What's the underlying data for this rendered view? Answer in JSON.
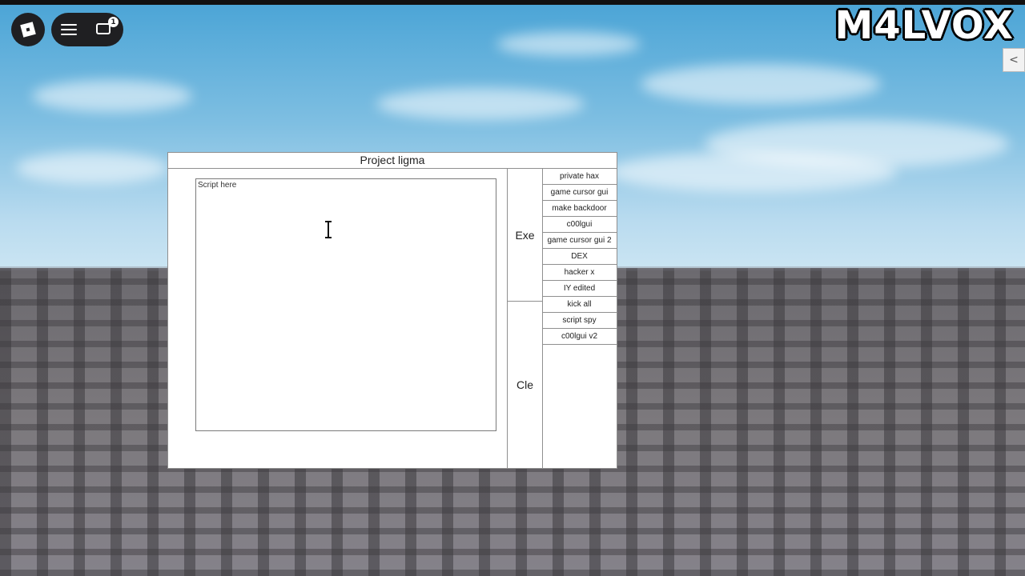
{
  "watermark": "M4LVOX",
  "roblox_topbar": {
    "logo_icon": "roblox-logo-icon",
    "menu_icon": "hamburger-menu-icon",
    "chat_icon": "chat-icon",
    "chat_badge": "1",
    "collapse_label": "<"
  },
  "gui": {
    "title": "Project ligma",
    "script_placeholder": "Script here",
    "execute_label": "Exe",
    "clear_label": "Cle",
    "scripts": [
      "private hax",
      "game cursor gui",
      "make backdoor",
      "c00lgui",
      "game cursor gui 2",
      "DEX",
      "hacker x",
      "IY edited",
      "kick all",
      "script spy",
      "c00lgui v2"
    ]
  },
  "colors": {
    "panel_bg": "#ffffff",
    "panel_border": "#8f8f8f",
    "sky": "#4aa4d6",
    "ground": "#7a777c"
  }
}
